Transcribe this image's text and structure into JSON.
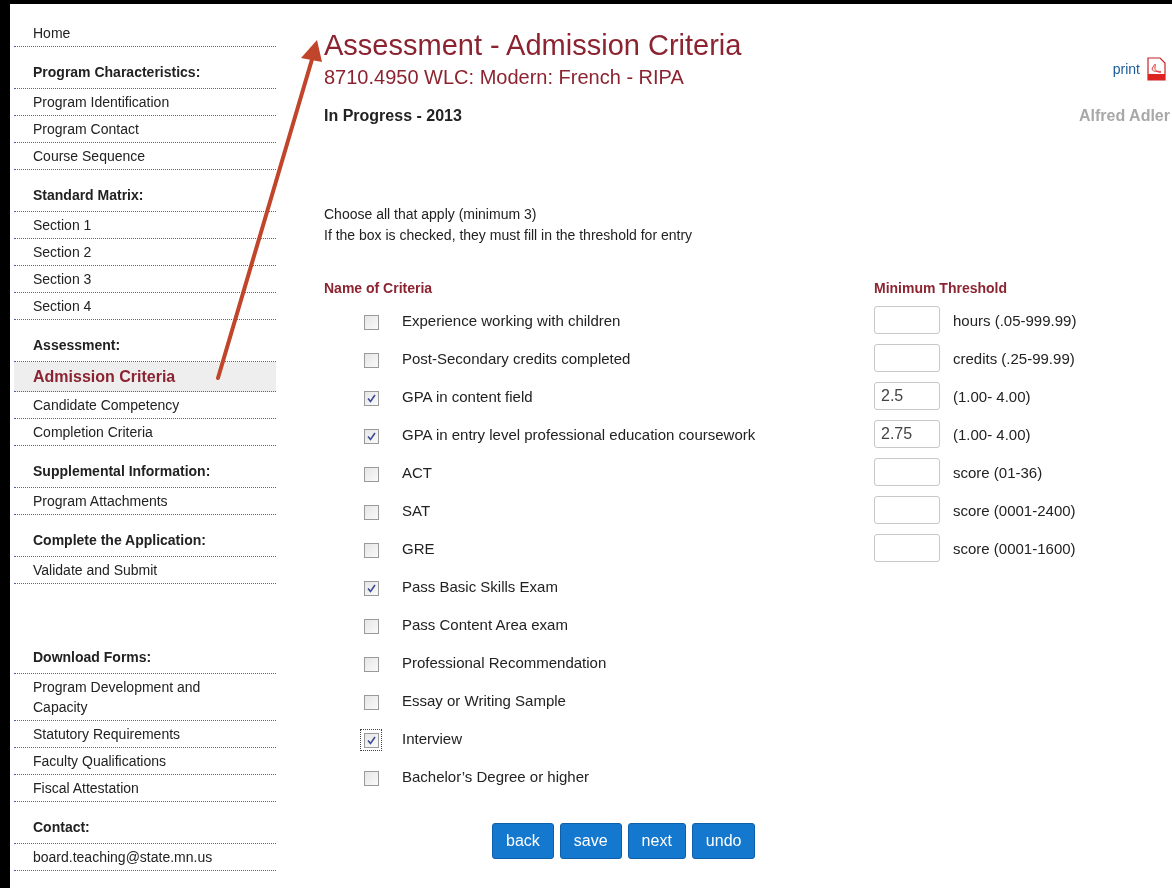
{
  "sidebar": {
    "sections": [
      {
        "spaced": false,
        "items": [
          {
            "label": "Home",
            "selected": false
          }
        ]
      },
      {
        "heading": "Program Characteristics:",
        "spaced": false,
        "items": [
          {
            "label": "Program Identification",
            "selected": false
          },
          {
            "label": "Program Contact",
            "selected": false
          },
          {
            "label": "Course Sequence",
            "selected": false
          }
        ]
      },
      {
        "heading": "Standard Matrix:",
        "spaced": false,
        "items": [
          {
            "label": "Section 1",
            "selected": false
          },
          {
            "label": "Section 2",
            "selected": false
          },
          {
            "label": "Section 3",
            "selected": false
          },
          {
            "label": "Section 4",
            "selected": false
          }
        ]
      },
      {
        "heading": "Assessment:",
        "spaced": false,
        "items": [
          {
            "label": "Admission Criteria",
            "selected": true
          },
          {
            "label": "Candidate Competency",
            "selected": false
          },
          {
            "label": "Completion Criteria",
            "selected": false
          }
        ]
      },
      {
        "heading": "Supplemental Information:",
        "spaced": false,
        "items": [
          {
            "label": "Program Attachments",
            "selected": false
          }
        ]
      },
      {
        "heading": "Complete the Application:",
        "spaced": false,
        "items": [
          {
            "label": "Validate and Submit",
            "selected": false
          }
        ]
      },
      {
        "heading": "Download Forms:",
        "spaced": true,
        "items": [
          {
            "label": "Program Development and Capacity",
            "selected": false
          },
          {
            "label": "Statutory Requirements",
            "selected": false
          },
          {
            "label": "Faculty Qualifications",
            "selected": false
          },
          {
            "label": "Fiscal Attestation",
            "selected": false
          }
        ]
      },
      {
        "heading": "Contact:",
        "spaced": false,
        "items": [
          {
            "label": "board.teaching@state.mn.us",
            "selected": false
          }
        ]
      }
    ]
  },
  "title": "Assessment - Admission Criteria",
  "subtitle": "8710.4950 WLC: Modern: French  -  RIPA",
  "print_link": "print",
  "user_name": "Alfred Adler",
  "status": "In Progress - 2013",
  "instructions": [
    "Choose all that apply (minimum 3)",
    "If the box is checked, they must fill in the threshold for entry"
  ],
  "columns": {
    "criteria": "Name of Criteria",
    "threshold": "Minimum Threshold"
  },
  "criteria": [
    {
      "label": "Experience working with children",
      "checked": false,
      "focused": false,
      "threshold": {
        "hint": "hours (.05-999.99)"
      }
    },
    {
      "label": "Post-Secondary credits completed",
      "checked": false,
      "focused": false,
      "threshold": {
        "hint": "credits (.25-99.99)"
      }
    },
    {
      "label": "GPA in content field",
      "checked": true,
      "focused": false,
      "threshold": {
        "value": "2.5",
        "hint": "(1.00- 4.00)"
      }
    },
    {
      "label": "GPA in entry level professional education coursework",
      "checked": true,
      "focused": false,
      "threshold": {
        "value": "2.75",
        "hint": "(1.00- 4.00)"
      }
    },
    {
      "label": "ACT",
      "checked": false,
      "focused": false,
      "threshold": {
        "hint": "score (01-36)"
      }
    },
    {
      "label": "SAT",
      "checked": false,
      "focused": false,
      "threshold": {
        "hint": "score (0001-2400)"
      }
    },
    {
      "label": "GRE",
      "checked": false,
      "focused": false,
      "threshold": {
        "hint": "score (0001-1600)"
      }
    },
    {
      "label": "Pass Basic Skills Exam",
      "checked": true,
      "focused": false
    },
    {
      "label": "Pass Content Area exam",
      "checked": false,
      "focused": false
    },
    {
      "label": "Professional Recommendation",
      "checked": false,
      "focused": false
    },
    {
      "label": "Essay or Writing Sample",
      "checked": false,
      "focused": false
    },
    {
      "label": "Interview",
      "checked": true,
      "focused": true
    },
    {
      "label": "Bachelor’s Degree or higher",
      "checked": false,
      "focused": false
    }
  ],
  "buttons": [
    "back",
    "save",
    "next",
    "undo"
  ]
}
